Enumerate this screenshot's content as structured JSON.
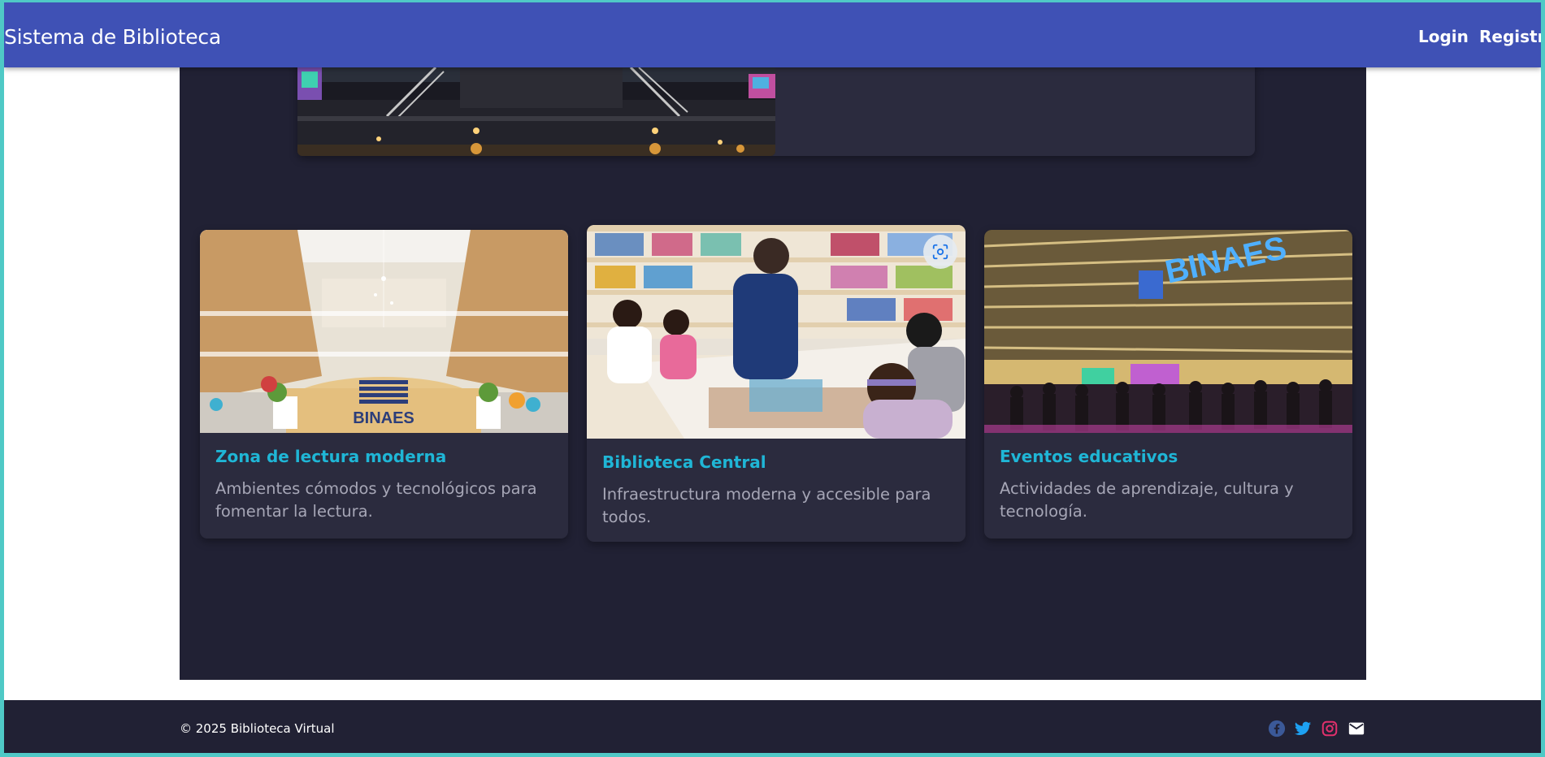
{
  "navbar": {
    "brand": "Sistema de Biblioteca",
    "links": [
      {
        "label": "Login"
      },
      {
        "label": "Registro"
      }
    ]
  },
  "cards": [
    {
      "title": "Zona de lectura moderna",
      "text": "Ambientes cómodos y tecnológicos para fomentar la lectura.",
      "image_sign": "BINAES"
    },
    {
      "title": "Biblioteca Central",
      "text": "Infraestructura moderna y accesible para todos."
    },
    {
      "title": "Eventos educativos",
      "text": "Actividades de aprendizaje, cultura y tecnología.",
      "image_sign": "BINAES"
    }
  ],
  "footer": {
    "copyright": "© 2025 Biblioteca Virtual",
    "social_icons": [
      "facebook-icon",
      "twitter-icon",
      "instagram-icon",
      "email-icon"
    ]
  },
  "colors": {
    "navbar": "#3f51b5",
    "page_dark": "#212134",
    "card": "#2b2b3e",
    "card_title": "#1fb6d6",
    "facebook": "#3b5998",
    "twitter": "#1da1f2",
    "instagram": "#e1306c"
  }
}
